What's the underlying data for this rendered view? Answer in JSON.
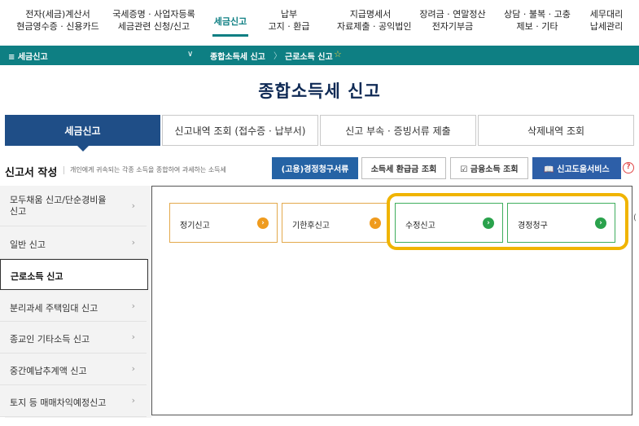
{
  "top_nav": [
    {
      "lines": [
        "전자(세금)계산서",
        "현금영수증 · 신용카드"
      ]
    },
    {
      "lines": [
        "국세증명 · 사업자등록",
        "세금관련 신청/신고"
      ]
    },
    {
      "lines": [
        "세금신고"
      ],
      "active": true
    },
    {
      "lines": [
        "납부",
        "고지 · 환급"
      ]
    },
    {
      "lines": [
        "지급명세서",
        "자료제출 · 공익법인"
      ]
    },
    {
      "lines": [
        "장려금 · 연말정산",
        "전자기부금"
      ]
    },
    {
      "lines": [
        "상담 · 불복 · 고충",
        "제보 · 기타"
      ]
    },
    {
      "lines": [
        "세무대리",
        "납세관리"
      ]
    }
  ],
  "breadcrumb": {
    "menu_label": "≡  세금신고",
    "dropdown_icon": "chevron-down-icon",
    "level1": "종합소득세 신고",
    "level2": "근로소득 신고",
    "favorite_icon": "star-icon"
  },
  "page_title": "종합소득세 신고",
  "tabs": [
    {
      "label": "세금신고",
      "active": true
    },
    {
      "label": "신고내역 조회 (접수증 · 납부서)"
    },
    {
      "label": "신고 부속 · 증빙서류 제출"
    },
    {
      "label": "삭제내역 조회"
    }
  ],
  "section": {
    "title": "신고서 작성",
    "description": "개인에게 귀속되는 각종 소득을 종합하여 과세하는 소득세"
  },
  "action_buttons": [
    {
      "label": "(고용)경정청구서류"
    },
    {
      "label": "소득세 환급금 조회"
    },
    {
      "label": "☑ 금융소득 조회"
    },
    {
      "label": "📖 신고도움서비스"
    }
  ],
  "help_label": "?",
  "sidebar": [
    {
      "label": "모두채움 신고/단순경비율\n신고"
    },
    {
      "label": "일반 신고"
    },
    {
      "label": "근로소득 신고",
      "active": true
    },
    {
      "label": "분리과세 주택임대 신고"
    },
    {
      "label": "종교인 기타소득 신고"
    },
    {
      "label": "중간예납추계액 신고"
    },
    {
      "label": "토지 등 매매차익예정신고"
    }
  ],
  "cards": [
    {
      "label": "정기신고",
      "style": "orange"
    },
    {
      "label": "기한후신고",
      "style": "orange"
    },
    {
      "label": "수정신고",
      "style": "green"
    },
    {
      "label": "경정청구",
      "style": "green"
    }
  ],
  "card_arrow": "›",
  "sidebar_arrow": "›",
  "colors": {
    "brand_teal": "#0e7f83",
    "tab_active": "#1f4e87",
    "highlight": "#f0b400",
    "orange": "#ef9b1e",
    "green": "#2aa24c"
  }
}
